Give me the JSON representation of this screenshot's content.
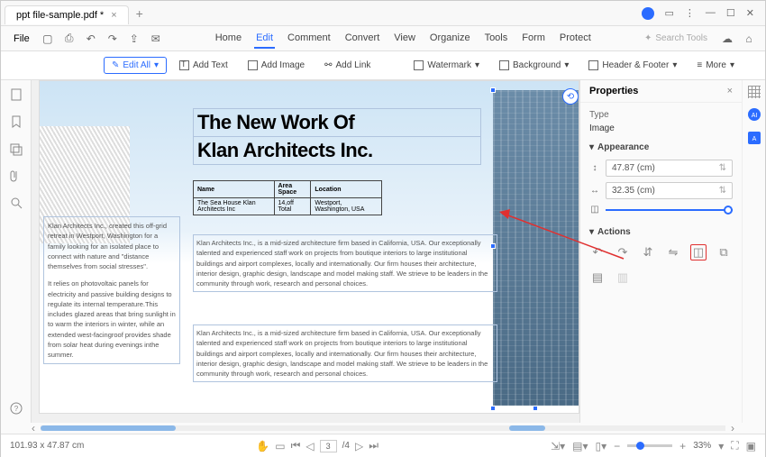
{
  "titlebar": {
    "tab_name": "ppt file-sample.pdf *"
  },
  "menubar": {
    "file": "File",
    "tabs": [
      "Home",
      "Edit",
      "Comment",
      "Convert",
      "View",
      "Organize",
      "Tools",
      "Form",
      "Protect"
    ],
    "active_tab": 1,
    "search_placeholder": "Search Tools"
  },
  "toolbar": {
    "edit_all": "Edit All",
    "add_text": "Add Text",
    "add_image": "Add Image",
    "add_link": "Add Link",
    "watermark": "Watermark",
    "background": "Background",
    "header_footer": "Header & Footer",
    "more": "More"
  },
  "document": {
    "headline_l1": "The New Work Of",
    "headline_l2": "Klan Architects Inc.",
    "table": {
      "h1": "Name",
      "h2": "Area Space",
      "h3": "Location",
      "c1": "The Sea House Klan Architects Inc",
      "c2": "14,off Total",
      "c3": "Westport, Washington, USA"
    },
    "left_p1": "Klan Architects Inc., created this off-grid retreat in Westport, Washington for a family looking for an isolated place to connect with nature and \"distance themselves from social stresses\".",
    "left_p2": "It relies on photovoltaic panels for electricity and passive building designs to regulate its internal temperature.This includes glazed areas that bring sunlight in to warm the interiors in winter, while an extended west-facingroof provides shade from solar heat during evenings inthe summer.",
    "body": "Klan Architects Inc., is a mid-sized architecture firm based in California, USA. Our exceptionally talented and experienced staff work on projects from boutique interiors to large institutional buildings and airport complexes, locally and internationally. Our firm houses their architecture, interior design, graphic design, landscape and model making staff. We strieve to be leaders in the community through work, research and personal choices."
  },
  "properties": {
    "title": "Properties",
    "type_lbl": "Type",
    "type_val": "Image",
    "appearance_lbl": "Appearance",
    "height": "47.87 (cm)",
    "width": "32.35 (cm)",
    "actions_lbl": "Actions"
  },
  "status": {
    "coords": "101.93 x 47.87 cm",
    "page": "3",
    "page_total": "/4",
    "zoom": "33%"
  }
}
